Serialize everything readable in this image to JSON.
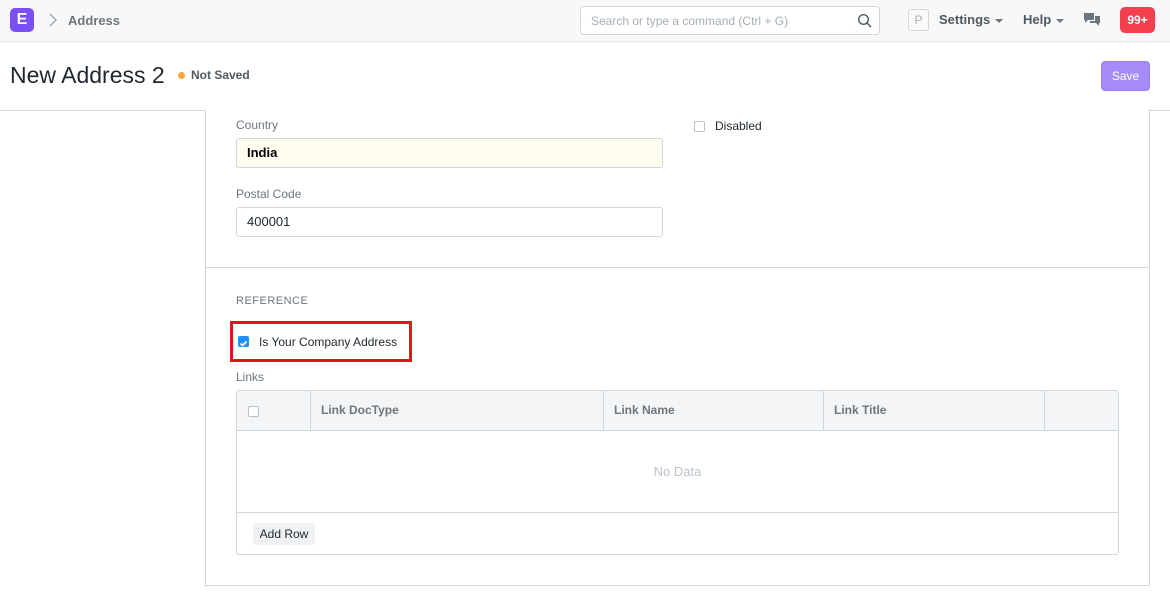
{
  "navbar": {
    "logo_letter": "E",
    "breadcrumb": "Address",
    "search_placeholder": "Search or type a command (Ctrl + G)",
    "avatar_letter": "P",
    "settings_label": "Settings",
    "help_label": "Help",
    "notifications_count": "99+"
  },
  "header": {
    "title": "New Address 2",
    "status": "Not Saved",
    "save_label": "Save"
  },
  "form": {
    "country_label": "Country",
    "country_value": "India",
    "postal_label": "Postal Code",
    "postal_value": "400001",
    "disabled_label": "Disabled",
    "disabled_checked": false
  },
  "reference": {
    "section_title": "REFERENCE",
    "company_address_label": "Is Your Company Address",
    "company_address_checked": true,
    "links_label": "Links",
    "columns": [
      "Link DocType",
      "Link Name",
      "Link Title"
    ],
    "empty_text": "No Data",
    "add_row_label": "Add Row"
  },
  "colors": {
    "brand": "#7a4ff5",
    "save_button": "#a58bf7",
    "badge": "#f43f4f",
    "status_dot": "#f8a73a",
    "highlight": "#e0161e",
    "checkbox_checked": "#2490ef"
  }
}
